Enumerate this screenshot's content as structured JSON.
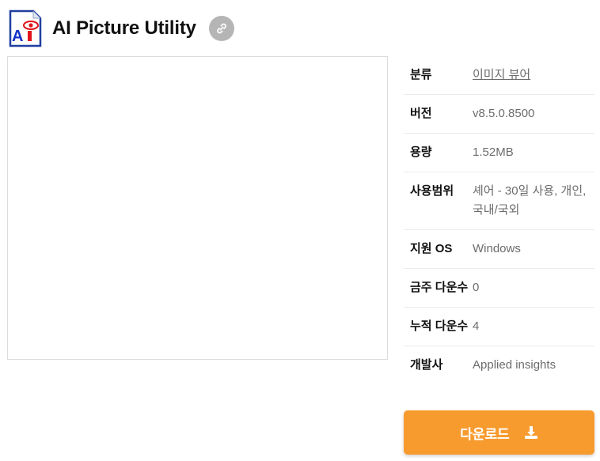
{
  "header": {
    "title": "AI Picture Utility",
    "app_icon": "ai-picture-utility-icon",
    "link_icon": "link-icon"
  },
  "preview": {
    "label": "screenshot-preview"
  },
  "info": {
    "rows": [
      {
        "label": "분류",
        "value": "이미지 뷰어",
        "is_link": true
      },
      {
        "label": "버전",
        "value": "v8.5.0.8500"
      },
      {
        "label": "용량",
        "value": "1.52MB"
      },
      {
        "label": "사용범위",
        "value": "셰어 - 30일 사용, 개인, 국내/국외"
      },
      {
        "label": "지원 OS",
        "value": "Windows"
      },
      {
        "label": "금주 다운수",
        "value": "0"
      },
      {
        "label": "누적 다운수",
        "value": "4"
      },
      {
        "label": "개발사",
        "value": "Applied insights"
      }
    ]
  },
  "download": {
    "label": "다운로드",
    "icon": "download-icon",
    "color": "#f89b2f"
  },
  "colors": {
    "accent": "#f89b2f",
    "link_button_bg": "#b5b5b5",
    "value_text": "#6c6c6c"
  }
}
